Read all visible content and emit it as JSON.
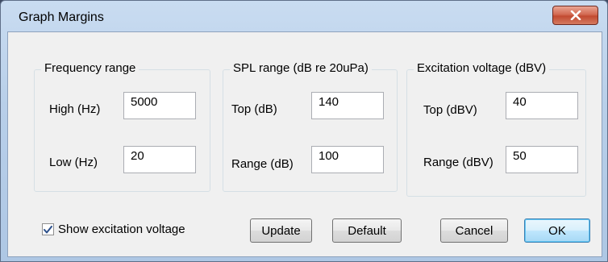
{
  "window": {
    "title": "Graph Margins",
    "close_icon": "close-x"
  },
  "frequency_range": {
    "label": "Frequency range",
    "high": {
      "label": "High (Hz)",
      "value": "5000"
    },
    "low": {
      "label": "Low (Hz)",
      "value": "20"
    }
  },
  "spl_range": {
    "label": "SPL range (dB re 20uPa)",
    "top": {
      "label": "Top (dB)",
      "value": "140"
    },
    "range": {
      "label": "Range (dB)",
      "value": "100"
    }
  },
  "excitation_voltage": {
    "label": "Excitation voltage (dBV)",
    "top": {
      "label": "Top (dBV)",
      "value": "40"
    },
    "range": {
      "label": "Range (dBV)",
      "value": "50"
    }
  },
  "show_excitation": {
    "label": "Show excitation voltage",
    "checked": true
  },
  "buttons": {
    "update": "Update",
    "default": "Default",
    "cancel": "Cancel",
    "ok": "OK"
  },
  "colors": {
    "close_button": "#c24a31",
    "default_button_border": "#3c7fb1",
    "title_bar": "#c9dcf1"
  }
}
